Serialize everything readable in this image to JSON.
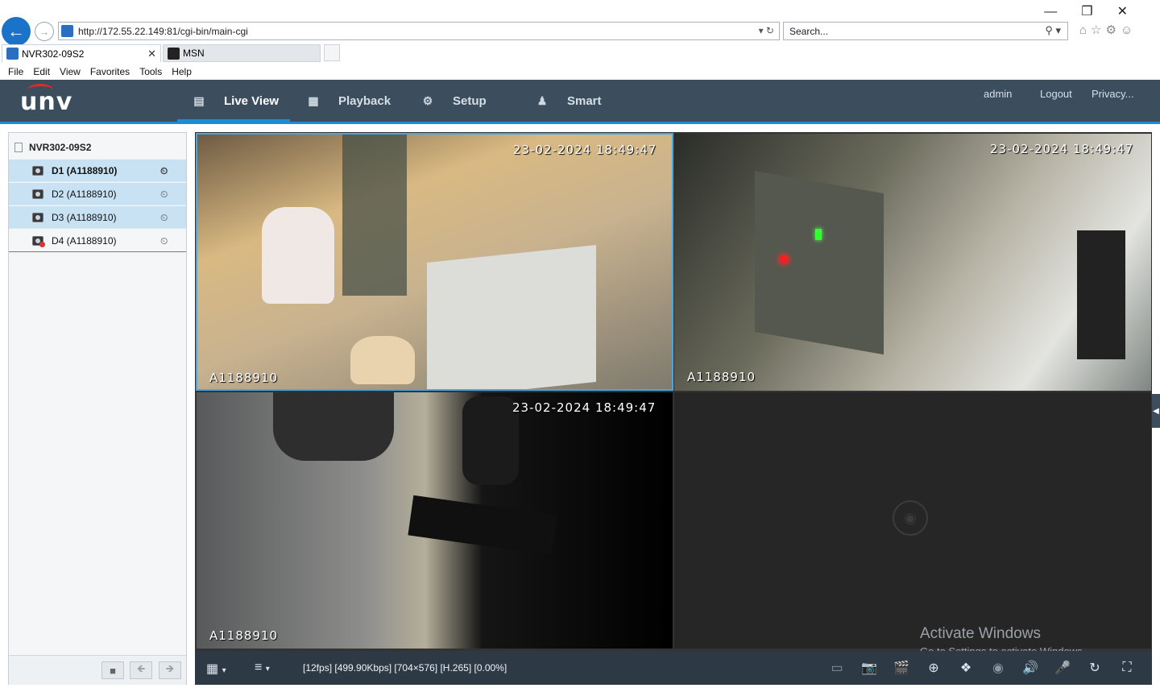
{
  "browser": {
    "url": "http://172.55.22.149:81/cgi-bin/main-cgi",
    "search_placeholder": "Search...",
    "tabs": [
      {
        "label": "NVR302-09S2",
        "active": true
      },
      {
        "label": "MSN",
        "active": false
      }
    ],
    "menu": [
      "File",
      "Edit",
      "View",
      "Favorites",
      "Tools",
      "Help"
    ]
  },
  "app": {
    "logo": "UNV",
    "nav": {
      "live_view": "Live View",
      "playback": "Playback",
      "setup": "Setup",
      "smart": "Smart"
    },
    "user": "admin",
    "logout": "Logout",
    "privacy": "Privacy..."
  },
  "sidebar": {
    "nvr_name": "NVR302-09S2",
    "devices": [
      {
        "label": "D1 (A1188910)",
        "selected": true,
        "online": true
      },
      {
        "label": "D2 (A1188910)",
        "selected": true,
        "online": true
      },
      {
        "label": "D3 (A1188910)",
        "selected": true,
        "online": true
      },
      {
        "label": "D4 (A1188910)",
        "selected": false,
        "online": false
      }
    ]
  },
  "video": {
    "tiles": [
      {
        "timestamp": "23-02-2024 18:49:47",
        "camera": "A1188910"
      },
      {
        "timestamp": "23-02-2024 18:49:47",
        "camera": "A1188910"
      },
      {
        "timestamp": "23-02-2024 18:49:47",
        "camera": "A1188910"
      }
    ],
    "status": "[12fps] [499.90Kbps] [704×576] [H.265] [0.00%]"
  },
  "watermark": {
    "line1": "Activate Windows",
    "line2": "Go to Settings to activate Windows."
  },
  "colors": {
    "header": "#3c4d5e",
    "accent": "#1c8dd4",
    "selection": "#c8e2f4",
    "toolbar": "#2d3a46"
  }
}
